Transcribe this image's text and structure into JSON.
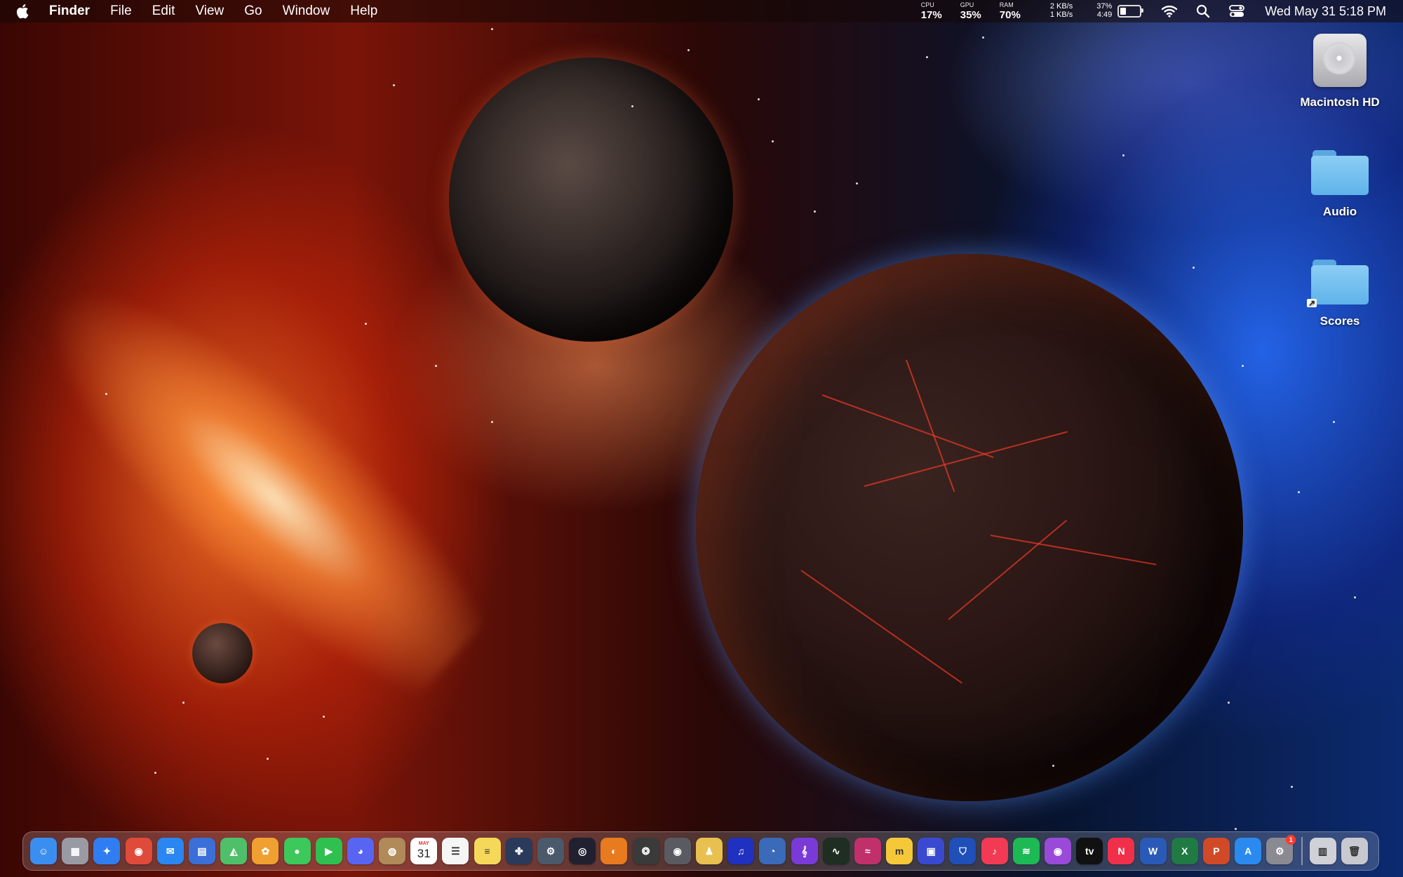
{
  "menubar": {
    "app_name": "Finder",
    "menus": [
      "File",
      "Edit",
      "View",
      "Go",
      "Window",
      "Help"
    ],
    "stats": [
      {
        "label": "CPU",
        "value": "17%"
      },
      {
        "label": "GPU",
        "value": "35%"
      },
      {
        "label": "RAM",
        "value": "70%"
      }
    ],
    "network": {
      "up": "2 KB/s",
      "down": "1 KB/s"
    },
    "battery": {
      "percent": "37%",
      "time": "4:49",
      "level": 0.37
    },
    "clock": "Wed May 31  5:18 PM",
    "icons": [
      "apple-logo-icon",
      "wifi-icon",
      "spotlight-search-icon",
      "control-center-icon"
    ]
  },
  "desktop_icons": [
    {
      "label": "Macintosh HD",
      "icon": "hard-drive-icon"
    },
    {
      "label": "Audio",
      "icon": "folder-icon"
    },
    {
      "label": "Scores",
      "icon": "folder-alias-icon",
      "alias_glyph": "↗"
    }
  ],
  "dock": {
    "apps": [
      {
        "icon": "finder-icon",
        "color": "#3a8ef0",
        "glyph": "☺"
      },
      {
        "icon": "launchpad-icon",
        "color": "#9a9aa5",
        "glyph": "▦"
      },
      {
        "icon": "safari-icon",
        "color": "#2f7df0",
        "glyph": "✦"
      },
      {
        "icon": "chrome-icon",
        "color": "#e04a3a",
        "glyph": "◉"
      },
      {
        "icon": "mail-icon",
        "color": "#2a86f0",
        "glyph": "✉"
      },
      {
        "icon": "files-icon",
        "color": "#3a6fd8",
        "glyph": "▤"
      },
      {
        "icon": "maps-icon",
        "color": "#4fbf6a",
        "glyph": "◭"
      },
      {
        "icon": "photos-icon",
        "color": "#f0a030",
        "glyph": "✿"
      },
      {
        "icon": "messages-icon",
        "color": "#3cc85a",
        "glyph": "●"
      },
      {
        "icon": "facetime-icon",
        "color": "#30c050",
        "glyph": "▶"
      },
      {
        "icon": "discord-icon",
        "color": "#5865f2",
        "glyph": "◕"
      },
      {
        "icon": "contacts-icon",
        "color": "#b08a58",
        "glyph": "◍"
      },
      {
        "icon": "calendar-icon",
        "color": "#ffffff",
        "calendar": true,
        "month": "MAY",
        "day": "31"
      },
      {
        "icon": "reminders-icon",
        "color": "#f5f5f5",
        "glyph": "☰",
        "dark": true
      },
      {
        "icon": "notes-icon",
        "color": "#f5d85a",
        "glyph": "≡",
        "dark": true
      },
      {
        "icon": "davinci-resolve-icon",
        "color": "#2a3a5a",
        "glyph": "✤"
      },
      {
        "icon": "automator-icon",
        "color": "#4a5a6a",
        "glyph": "⚙"
      },
      {
        "icon": "obs-icon",
        "color": "#202030",
        "glyph": "◎"
      },
      {
        "icon": "blender-icon",
        "color": "#e87a20",
        "glyph": "◐"
      },
      {
        "icon": "aperture-icon",
        "color": "#3a3a3a",
        "glyph": "❂"
      },
      {
        "icon": "disk-utility-icon",
        "color": "#5a5a62",
        "glyph": "◉"
      },
      {
        "icon": "character-app-icon",
        "color": "#e8c050",
        "glyph": "♟"
      },
      {
        "icon": "headphones-app-icon",
        "color": "#2030c0",
        "glyph": "♫"
      },
      {
        "icon": "scanner-icon",
        "color": "#3a6ab8",
        "glyph": "◔"
      },
      {
        "icon": "musescore-icon",
        "color": "#7a3ad8",
        "glyph": "𝄞"
      },
      {
        "icon": "activity-monitor-icon",
        "color": "#1e2e22",
        "glyph": "∿"
      },
      {
        "icon": "audio-app-icon",
        "color": "#c0306a",
        "glyph": "≈"
      },
      {
        "icon": "miro-icon",
        "color": "#f5c83a",
        "glyph": "m",
        "dark": true
      },
      {
        "icon": "app-frame-icon",
        "color": "#3a4ad0",
        "glyph": "▣"
      },
      {
        "icon": "bitwarden-icon",
        "color": "#1f4fb8",
        "glyph": "⛉"
      },
      {
        "icon": "music-icon",
        "color": "#f23a55",
        "glyph": "♪"
      },
      {
        "icon": "spotify-icon",
        "color": "#1db954",
        "glyph": "≋"
      },
      {
        "icon": "podcasts-icon",
        "color": "#9a4ad8",
        "glyph": "◉"
      },
      {
        "icon": "apple-tv-icon",
        "color": "#111111",
        "glyph": "tv"
      },
      {
        "icon": "news-icon",
        "color": "#f0304a",
        "glyph": "N"
      },
      {
        "icon": "word-icon",
        "color": "#2a5ab8",
        "glyph": "W"
      },
      {
        "icon": "excel-icon",
        "color": "#1f7a44",
        "glyph": "X"
      },
      {
        "icon": "powerpoint-icon",
        "color": "#d04a28",
        "glyph": "P"
      },
      {
        "icon": "app-store-icon",
        "color": "#2a8af0",
        "glyph": "A"
      },
      {
        "icon": "system-settings-icon",
        "color": "#8a8a92",
        "glyph": "⚙",
        "badge": "1"
      }
    ],
    "after_separator": [
      {
        "icon": "downloads-stack-icon",
        "color": "#d0d0d8",
        "glyph": "▥",
        "dark": true
      },
      {
        "icon": "trash-icon",
        "color": "#c8c8d0",
        "glyph": "🗑",
        "dark": true
      }
    ]
  }
}
